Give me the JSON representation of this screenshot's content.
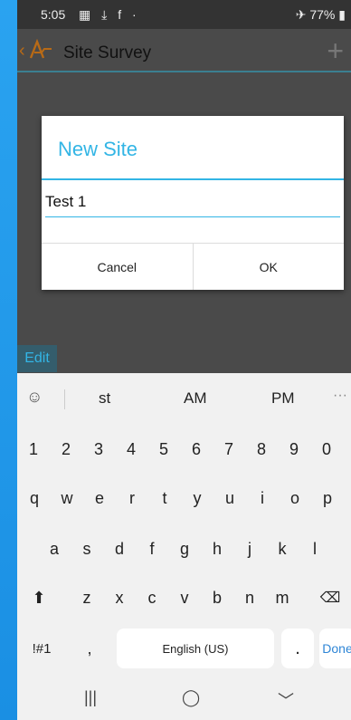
{
  "status_bar": {
    "time": "5:05",
    "notification_icons": [
      "image-icon",
      "download-icon",
      "facebook-icon"
    ],
    "right_text": "77%"
  },
  "action_bar": {
    "title": "Site Survey"
  },
  "dialog": {
    "title": "New Site",
    "input_value": "Test 1",
    "cancel_label": "Cancel",
    "ok_label": "OK"
  },
  "edit_button": {
    "label": "Edit"
  },
  "keyboard": {
    "suggestions": [
      "st",
      "AM",
      "PM"
    ],
    "number_row": [
      "1",
      "2",
      "3",
      "4",
      "5",
      "6",
      "7",
      "8",
      "9",
      "0"
    ],
    "row1": [
      "q",
      "w",
      "e",
      "r",
      "t",
      "y",
      "u",
      "i",
      "o",
      "p"
    ],
    "row2": [
      "a",
      "s",
      "d",
      "f",
      "g",
      "h",
      "j",
      "k",
      "l"
    ],
    "row3": [
      "z",
      "x",
      "c",
      "v",
      "b",
      "n",
      "m"
    ],
    "symbols_label": "!#1",
    "comma_label": ",",
    "space_label": "English (US)",
    "period_label": ".",
    "done_label": "Done"
  },
  "colors": {
    "accent": "#33b5e5",
    "background": "#2aa1ee",
    "dim_overlay": "#4a4a4a"
  }
}
